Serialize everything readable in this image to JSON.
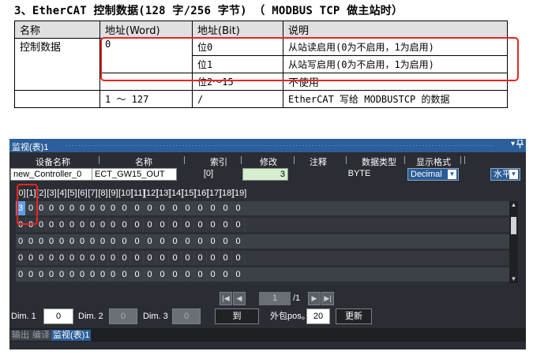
{
  "doc": {
    "title": "3、EtherCAT 控制数据(128 字/256 字节) （ MODBUS TCP 做主站时）",
    "columns": [
      "名称",
      "地址(Word)",
      "地址(Bit)",
      "说明"
    ],
    "rows": [
      {
        "name": "控制数据",
        "word": "0",
        "bit": "位0",
        "desc": "从站读启用(0为不启用，1为启用)"
      },
      {
        "name": "",
        "word": "",
        "bit": "位1",
        "desc": "从站写启用(0为不启用，1为启用)"
      },
      {
        "name": "",
        "word": "",
        "bit": "位2～15",
        "desc": "不使用"
      },
      {
        "name": "",
        "word": "1 ～ 127",
        "bit": "/",
        "desc": "EtherCAT 写给 MODBUSTCP 的数据"
      }
    ]
  },
  "panel": {
    "title": "监视(表)1",
    "title_arrow": "▾",
    "pin_icon": "pin-icon",
    "headers": {
      "device": "设备名称",
      "name": "名称",
      "index": "索引",
      "modify": "修改",
      "comment": "注释",
      "datatype": "数据类型",
      "display": "显示格式"
    },
    "fields": {
      "device": "new_Controller_0",
      "name": "ECT_GW15_OUT",
      "index": "[0]",
      "modify": "3",
      "comment": "",
      "datatype": "BYTE",
      "display": "Decimal",
      "orientation": "水平"
    },
    "grid": {
      "indices": [
        "[0]",
        "[1]",
        "[2]",
        "[3]",
        "[4]",
        "[5]",
        "[6]",
        "[7]",
        "[8]",
        "[9]",
        "[10]",
        "[11]",
        "[12]",
        "[13]",
        "[14]",
        "[15]",
        "[16]",
        "[17]",
        "[18]",
        "[19]"
      ],
      "rows": [
        [
          "3",
          "0",
          "0",
          "0",
          "0",
          "0",
          "0",
          "0",
          "0",
          "0",
          "0",
          "0",
          "0",
          "0",
          "0",
          "0",
          "0",
          "0",
          "0",
          "0"
        ],
        [
          "0",
          "0",
          "0",
          "0",
          "0",
          "0",
          "0",
          "0",
          "0",
          "0",
          "0",
          "0",
          "0",
          "0",
          "0",
          "0",
          "0",
          "0",
          "0",
          "0"
        ],
        [
          "0",
          "0",
          "0",
          "0",
          "0",
          "0",
          "0",
          "0",
          "0",
          "0",
          "0",
          "0",
          "0",
          "0",
          "0",
          "0",
          "0",
          "0",
          "0",
          "0"
        ],
        [
          "0",
          "0",
          "0",
          "0",
          "0",
          "0",
          "0",
          "0",
          "0",
          "0",
          "0",
          "0",
          "0",
          "0",
          "0",
          "0",
          "0",
          "0",
          "0",
          "0"
        ],
        [
          "0",
          "0",
          "0",
          "0",
          "0",
          "0",
          "0",
          "0",
          "0",
          "0",
          "0",
          "0",
          "0",
          "0",
          "0",
          "0",
          "0",
          "0",
          "0",
          "0"
        ]
      ]
    },
    "pager": {
      "current": "1",
      "total": "/1"
    },
    "bottom": {
      "dim1_label": "Dim. 1",
      "dim1_value": "0",
      "dim2_label": "Dim. 2",
      "dim2_value": "0",
      "dim3_label": "Dim. 3",
      "dim3_value": "0",
      "goto_label": "到",
      "outer_pos_label": "外包pos。",
      "outer_pos_value": "20",
      "refresh_label": "更新"
    },
    "tabs": [
      "输出",
      "编译",
      "监视(表)1"
    ],
    "colors": {
      "titlebar": "#2c5f9a",
      "panel_bg": "#2a2d33",
      "selected_cell": "#5aa0e6",
      "highlight": "#e8251e"
    }
  }
}
